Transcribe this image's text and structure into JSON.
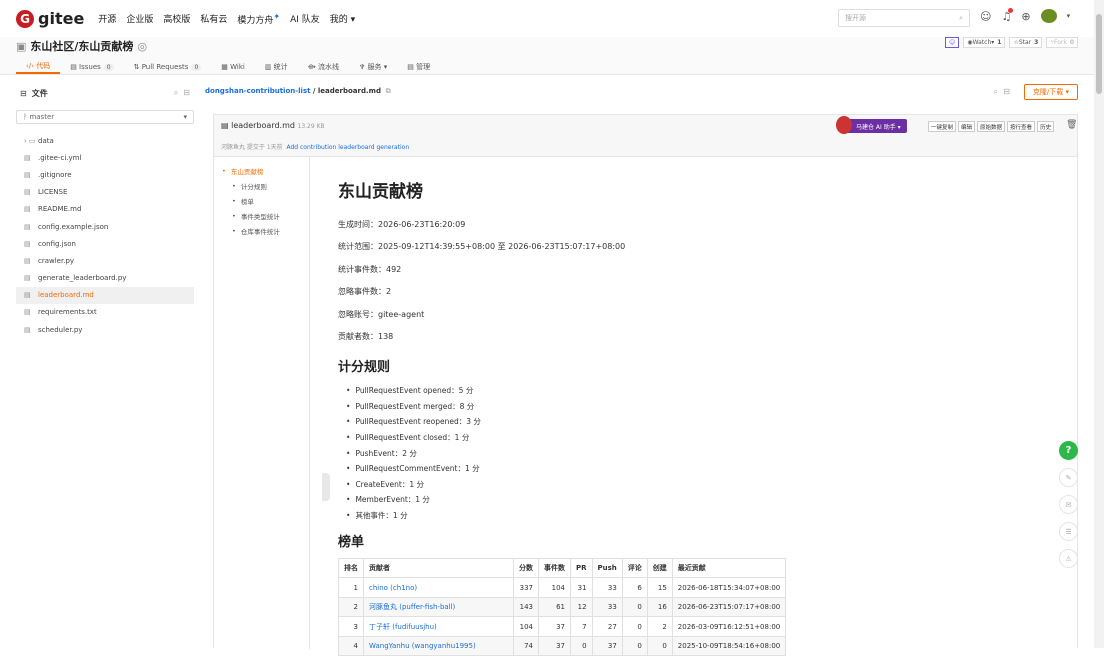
{
  "topnav": {
    "logo": "gitee",
    "items": [
      "开源",
      "企业版",
      "高校版",
      "私有云",
      "模力方舟",
      "AI 队友",
      "我的 ▾"
    ],
    "search_placeholder": "搜开源"
  },
  "repo": {
    "title": "东山社区/东山贡献榜",
    "watch_label": "Watch",
    "watch_count": "1",
    "star_label": "Star",
    "star_count": "3",
    "fork_label": "Fork",
    "fork_count": "0"
  },
  "tabs": [
    {
      "label": "代码",
      "count": ""
    },
    {
      "label": "Issues",
      "count": "0"
    },
    {
      "label": "Pull Requests",
      "count": "0"
    },
    {
      "label": "Wiki",
      "count": ""
    },
    {
      "label": "统计",
      "count": ""
    },
    {
      "label": "流水线",
      "count": ""
    },
    {
      "label": "服务 ▾",
      "count": ""
    },
    {
      "label": "管理",
      "count": ""
    }
  ],
  "sidebar": {
    "title": "文件",
    "branch": "master",
    "files": [
      {
        "name": "data",
        "type": "folder"
      },
      {
        "name": ".gitee-ci.yml",
        "type": "file"
      },
      {
        "name": ".gitignore",
        "type": "file"
      },
      {
        "name": "LICENSE",
        "type": "file"
      },
      {
        "name": "README.md",
        "type": "file"
      },
      {
        "name": "config.example.json",
        "type": "file"
      },
      {
        "name": "config.json",
        "type": "file"
      },
      {
        "name": "crawler.py",
        "type": "file"
      },
      {
        "name": "generate_leaderboard.py",
        "type": "file"
      },
      {
        "name": "leaderboard.md",
        "type": "file"
      },
      {
        "name": "requirements.txt",
        "type": "file"
      },
      {
        "name": "scheduler.py",
        "type": "file"
      }
    ]
  },
  "breadcrumb": {
    "repo": "dongshan-contribution-list",
    "sep": " / ",
    "file": "leaderboard.md"
  },
  "clone_label": "克隆/下载 ▾",
  "file": {
    "name": "leaderboard.md",
    "size": "13.29 KB",
    "commit_meta": "河豚鱼丸 提交于 1天前",
    "commit_msg": "Add contribution leaderboard generation",
    "ai_button": "马建仓 AI 助手 ▾",
    "buttons": [
      "一键复制",
      "编辑",
      "原始数据",
      "按行查看",
      "历史"
    ]
  },
  "toc": [
    {
      "label": "东山贡献榜",
      "level": 1
    },
    {
      "label": "计分规则",
      "level": 2
    },
    {
      "label": "榜单",
      "level": 2
    },
    {
      "label": "事件类型统计",
      "level": 2
    },
    {
      "label": "仓库事件统计",
      "level": 2
    }
  ],
  "doc": {
    "h1": "东山贡献榜",
    "meta": [
      "生成时间：2026-06-23T16:20:09",
      "统计范围：2025-09-12T14:39:55+08:00 至 2026-06-23T15:07:17+08:00",
      "统计事件数：492",
      "忽略事件数：2",
      "忽略账号：gitee-agent",
      "贡献者数：138"
    ],
    "h2_rules": "计分规则",
    "rules": [
      "PullRequestEvent opened：5 分",
      "PullRequestEvent merged：8 分",
      "PullRequestEvent reopened：3 分",
      "PullRequestEvent closed：1 分",
      "PushEvent：2 分",
      "PullRequestCommentEvent：1 分",
      "CreateEvent：1 分",
      "MemberEvent：1 分",
      "其他事件：1 分"
    ],
    "h2_board": "榜单",
    "table": {
      "headers": [
        "排名",
        "贡献者",
        "分数",
        "事件数",
        "PR",
        "Push",
        "评论",
        "创建",
        "最近贡献"
      ],
      "rows": [
        [
          "1",
          "chino (ch1no)",
          "337",
          "104",
          "31",
          "33",
          "6",
          "15",
          "2026-06-18T15:34:07+08:00"
        ],
        [
          "2",
          "河豚鱼丸 (puffer-fish-ball)",
          "143",
          "61",
          "12",
          "33",
          "0",
          "16",
          "2026-06-23T15:07:17+08:00"
        ],
        [
          "3",
          "丁子轩 (fudifuusjhu)",
          "104",
          "37",
          "7",
          "27",
          "0",
          "2",
          "2026-03-09T16:12:51+08:00"
        ],
        [
          "4",
          "WangYanhu (wangyanhu1995)",
          "74",
          "37",
          "0",
          "37",
          "0",
          "0",
          "2025-10-09T18:54:16+08:00"
        ]
      ]
    }
  },
  "help_label": "?"
}
